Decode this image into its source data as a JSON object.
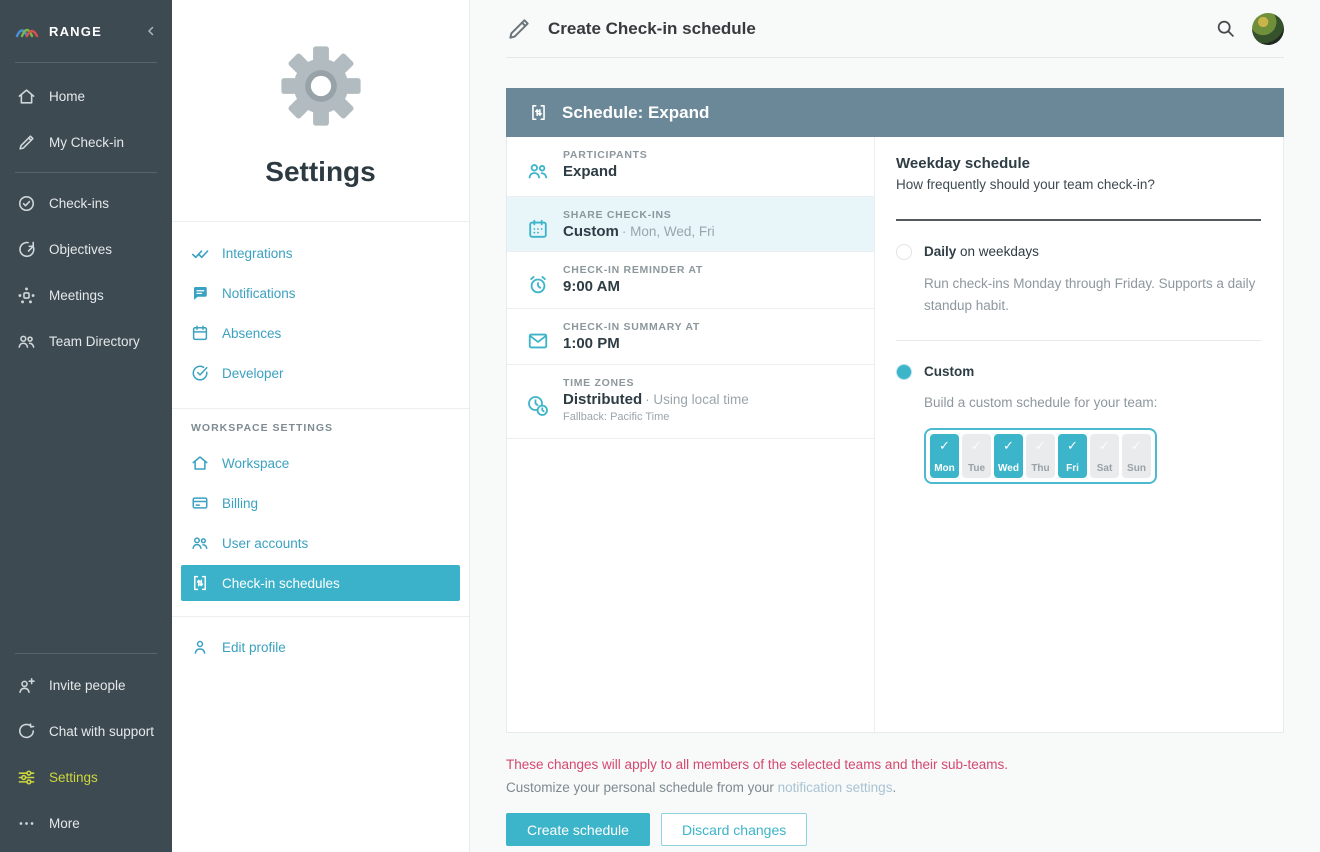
{
  "colors": {
    "accent_teal": "#3cb4ca",
    "sidebar_bg": "#3e4a52",
    "active_yellow": "#ccd63d",
    "card_header_bg": "#6b8899",
    "highlight_row_bg": "#e8f5f9",
    "warning_red": "#d4496e",
    "link_blue": "#a9c3d3"
  },
  "sidebar": {
    "brand": "RANGE",
    "items": [
      {
        "label": "Home",
        "icon": "home-icon"
      },
      {
        "label": "My Check-in",
        "icon": "pencil-icon"
      },
      {
        "label": "Check-ins",
        "icon": "check-circle-icon"
      },
      {
        "label": "Objectives",
        "icon": "target-arrow-icon"
      },
      {
        "label": "Meetings",
        "icon": "meeting-table-icon"
      },
      {
        "label": "Team Directory",
        "icon": "people-icon"
      }
    ],
    "footer_items": [
      {
        "label": "Invite people",
        "icon": "person-plus-icon"
      },
      {
        "label": "Chat with support",
        "icon": "chat-bubble-icon"
      },
      {
        "label": "Settings",
        "icon": "sliders-icon",
        "active": true
      },
      {
        "label": "More",
        "icon": "ellipsis-icon"
      }
    ]
  },
  "settings_panel": {
    "title": "Settings",
    "menu": [
      {
        "label": "Integrations",
        "icon": "double-check-icon"
      },
      {
        "label": "Notifications",
        "icon": "message-square-icon"
      },
      {
        "label": "Absences",
        "icon": "calendar-icon"
      },
      {
        "label": "Developer",
        "icon": "check-circle-icon"
      }
    ],
    "workspace_section_label": "WORKSPACE SETTINGS",
    "workspace_menu": [
      {
        "label": "Workspace",
        "icon": "home-icon"
      },
      {
        "label": "Billing",
        "icon": "credit-card-icon"
      },
      {
        "label": "User accounts",
        "icon": "people-icon"
      },
      {
        "label": "Check-in schedules",
        "icon": "sync-brackets-icon",
        "active": true
      }
    ],
    "profile_menu": [
      {
        "label": "Edit profile",
        "icon": "person-icon"
      }
    ]
  },
  "header": {
    "title": "Create Check-in schedule"
  },
  "schedule_card": {
    "header_title": "Schedule: Expand",
    "rows": [
      {
        "label": "PARTICIPANTS",
        "value": "Expand",
        "suffix": "",
        "note": "",
        "icon": "people-icon"
      },
      {
        "label": "SHARE CHECK-INS",
        "value": "Custom",
        "suffix": "· Mon, Wed, Fri",
        "note": "",
        "icon": "calendar-grid-icon",
        "highlighted": true
      },
      {
        "label": "CHECK-IN REMINDER AT",
        "value": "9:00 AM",
        "suffix": "",
        "note": "",
        "icon": "alarm-clock-icon"
      },
      {
        "label": "CHECK-IN SUMMARY AT",
        "value": "1:00 PM",
        "suffix": "",
        "note": "",
        "icon": "envelope-icon"
      },
      {
        "label": "TIME ZONES",
        "value": "Distributed",
        "suffix": "· Using local time",
        "note": "Fallback: Pacific Time",
        "icon": "time-zones-icon"
      }
    ],
    "weekday": {
      "title": "Weekday schedule",
      "subtitle": "How frequently should your team check-in?",
      "options": [
        {
          "label": "Daily",
          "suffix": " on weekdays",
          "description": "Run check-ins Monday through Friday. Supports a daily standup habit.",
          "selected": false
        },
        {
          "label": "Custom",
          "suffix": "",
          "description": "Build a custom schedule for your team:",
          "selected": true
        }
      ],
      "check_glyph": "✓",
      "days": [
        {
          "label": "Mon",
          "selected": true
        },
        {
          "label": "Tue",
          "selected": false
        },
        {
          "label": "Wed",
          "selected": true
        },
        {
          "label": "Thu",
          "selected": false
        },
        {
          "label": "Fri",
          "selected": true
        },
        {
          "label": "Sat",
          "selected": false
        },
        {
          "label": "Sun",
          "selected": false
        }
      ]
    }
  },
  "footer": {
    "warning": "These changes will apply to all members of the selected teams and their sub-teams.",
    "note_prefix": "Customize your personal schedule from your ",
    "note_link": "notification settings",
    "note_suffix": ".",
    "primary_button": "Create schedule",
    "secondary_button": "Discard changes"
  }
}
